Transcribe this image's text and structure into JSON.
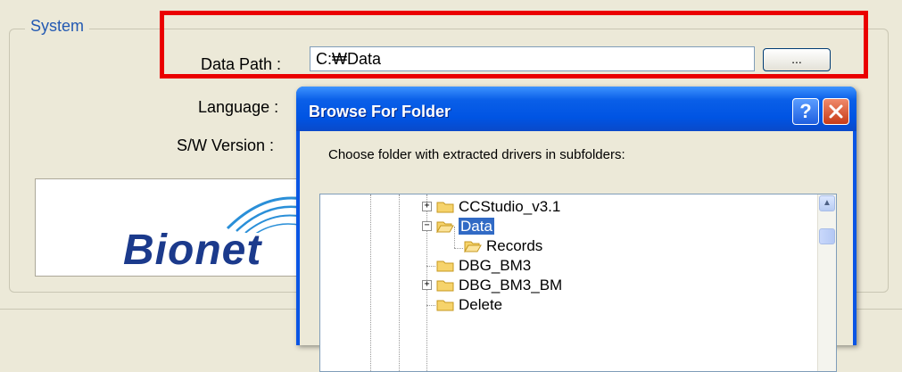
{
  "system": {
    "group_title": "System",
    "data_path_label": "Data Path :",
    "data_path_value": "C:₩Data",
    "browse_label": "...",
    "language_label": "Language :",
    "sw_version_label": "S/W Version :",
    "logo_text": "Bionet"
  },
  "dialog": {
    "title": "Browse For Folder",
    "help_label": "?",
    "instruction": "Choose folder with extracted drivers in subfolders:",
    "tree_items": [
      {
        "label": "CCStudio_v3.1",
        "expander": "+"
      },
      {
        "label": "Data",
        "expander": "−",
        "selected": true
      },
      {
        "label": "Records",
        "expander": ""
      },
      {
        "label": "DBG_BM3",
        "expander": ""
      },
      {
        "label": "DBG_BM3_BM",
        "expander": "+"
      },
      {
        "label": "Delete",
        "expander": ""
      }
    ]
  },
  "colors": {
    "highlight": "#ea0000",
    "titlebar": "#0054e3",
    "selection": "#316ac5",
    "logo": "#1b3a8c"
  },
  "icons": [
    "folder-icon",
    "open-folder-icon",
    "help-icon",
    "close-icon",
    "scroll-up-icon"
  ]
}
